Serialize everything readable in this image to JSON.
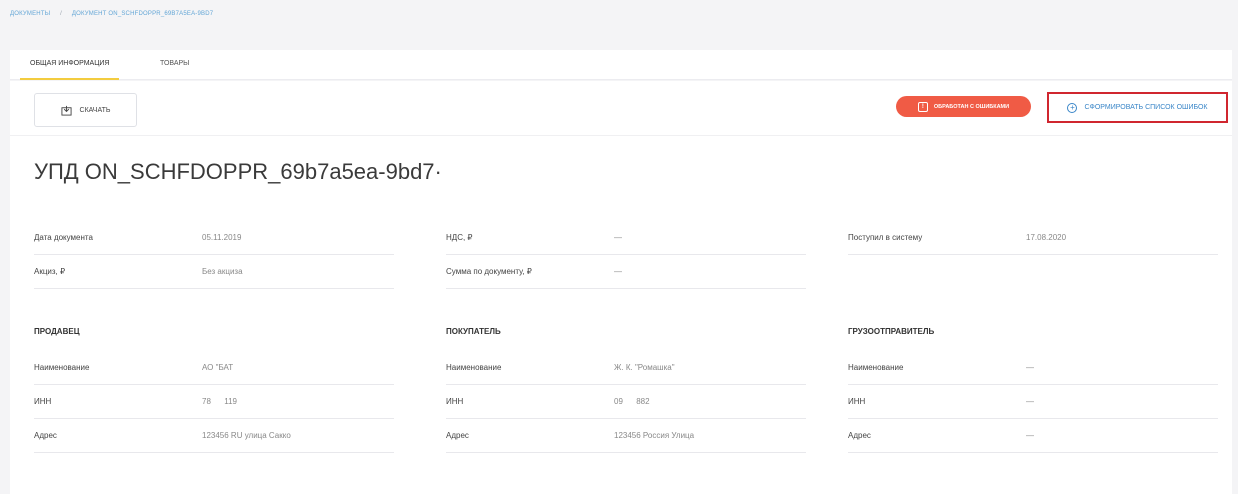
{
  "breadcrumb": {
    "root": "ДОКУМЕНТЫ",
    "separator": "/",
    "current": "ДОКУМЕНТ ON_SCHFDOPPR_69b7a5ea-9bd7"
  },
  "tabs": [
    {
      "label": "ОБЩАЯ ИНФОРМАЦИЯ",
      "active": true
    },
    {
      "label": "ТОВАРЫ",
      "active": false
    }
  ],
  "toolbar": {
    "download_label": "СКАЧАТЬ",
    "status_badge": "ОБРАБОТАН С ОШИБКАМИ",
    "form_errors_label": "СФОРМИРОВАТЬ СПИСОК ОШИБОК"
  },
  "document_title": "УПД ON_SCHFDOPPR_69b7a5ea-9bd7·",
  "summary": {
    "col1": [
      {
        "label": "Дата документа",
        "value": "05.11.2019"
      },
      {
        "label": "Акциз, ₽",
        "value": "Без акциза"
      }
    ],
    "col2": [
      {
        "label": "НДС, ₽",
        "value": "—"
      },
      {
        "label": "Сумма по документу, ₽",
        "value": "—"
      }
    ],
    "col3": [
      {
        "label": "Поступил в систему",
        "value": "17.08.2020"
      }
    ]
  },
  "seller": {
    "title": "ПРОДАВЕЦ",
    "rows": [
      {
        "label": "Наименование",
        "value": "АО \"БАТ"
      },
      {
        "label": "ИНН",
        "value": "78      119"
      },
      {
        "label": "Адрес",
        "value": "123456 RU улица Сакко"
      }
    ]
  },
  "buyer": {
    "title": "ПОКУПАТЕЛЬ",
    "rows": [
      {
        "label": "Наименование",
        "value": "Ж. К. \"Ромашка\""
      },
      {
        "label": "ИНН",
        "value": "09      882"
      },
      {
        "label": "Адрес",
        "value": "123456 Россия Улица"
      }
    ]
  },
  "shipper": {
    "title": "ГРУЗООТПРАВИТЕЛЬ",
    "rows": [
      {
        "label": "Наименование",
        "value": "—"
      },
      {
        "label": "ИНН",
        "value": "—"
      },
      {
        "label": "Адрес",
        "value": "—"
      }
    ]
  },
  "colors": {
    "accent_link": "#3a86c8",
    "tab_underline": "#f3cc3f",
    "error_badge": "#f05b45",
    "highlight_border": "#d0262f"
  }
}
